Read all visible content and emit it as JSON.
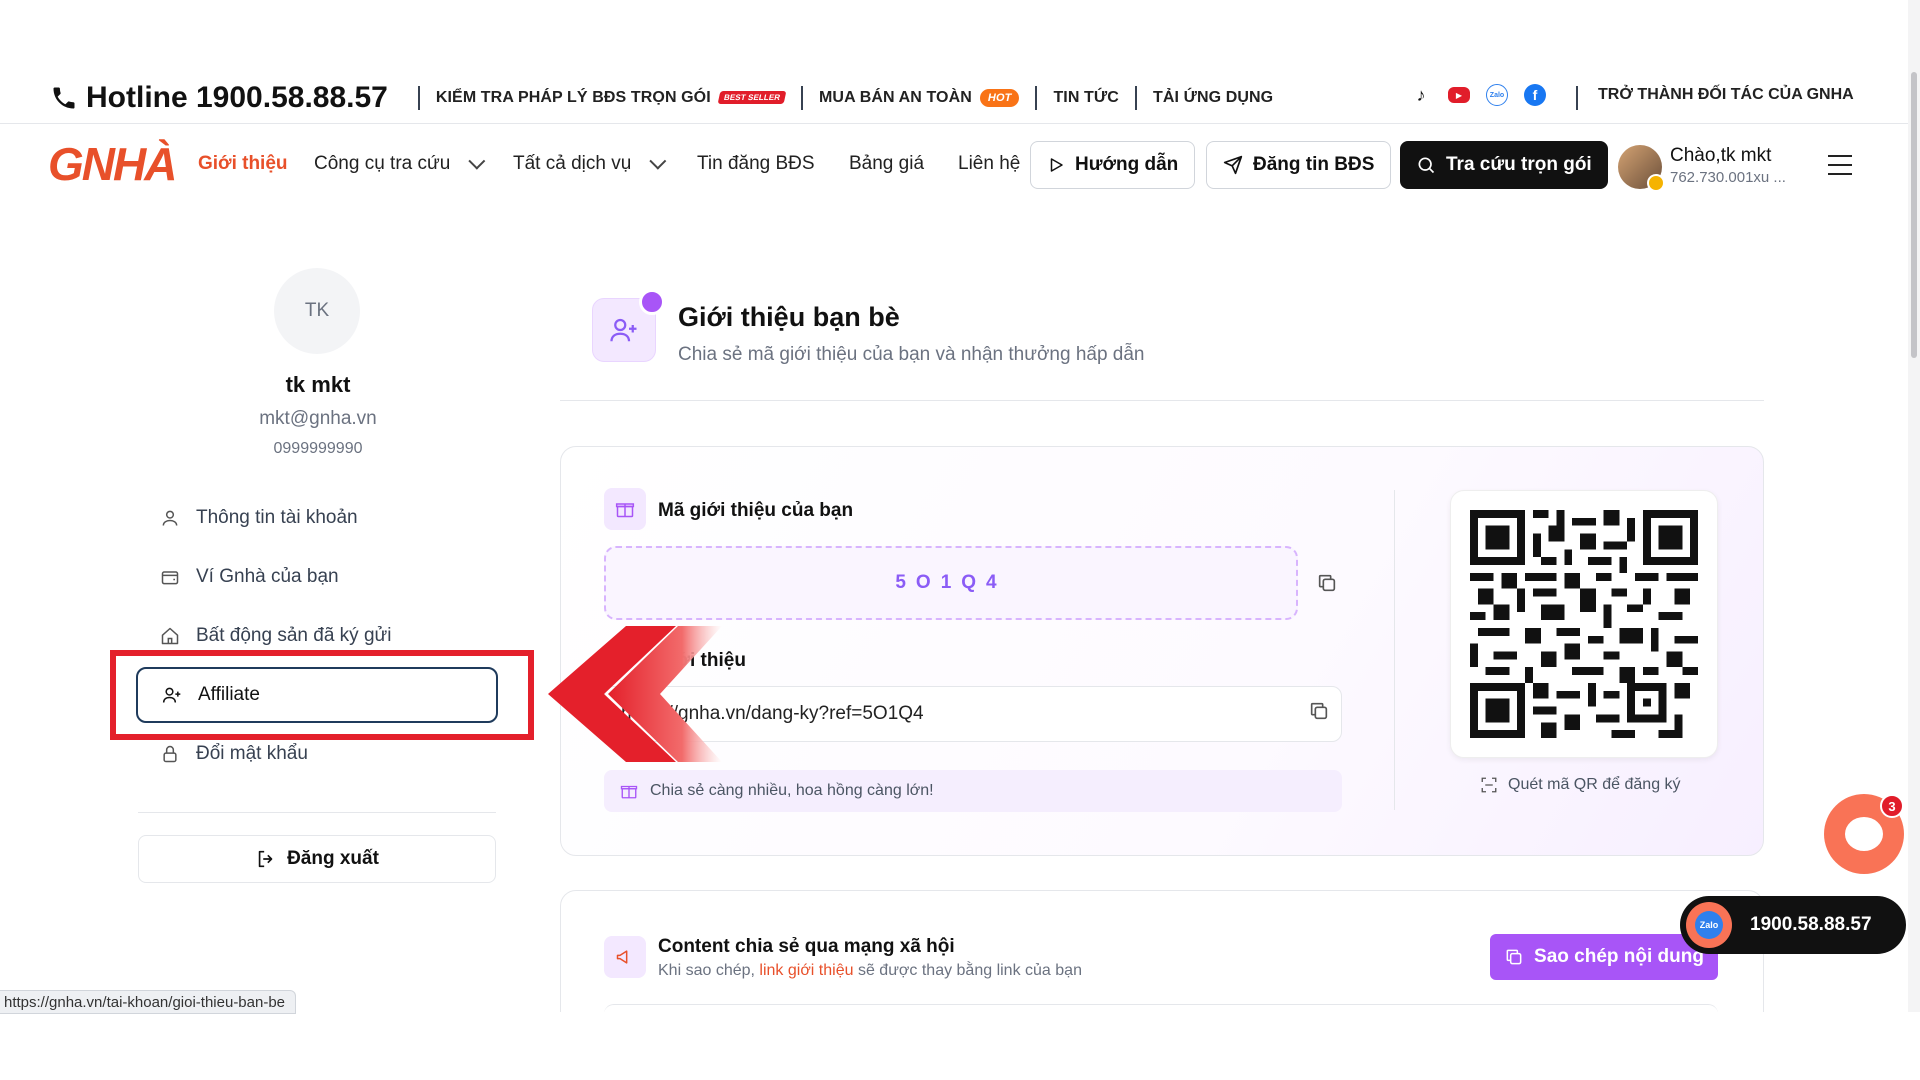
{
  "topbar": {
    "hotline": "Hotline 1900.58.88.57",
    "links": [
      {
        "label": "KIỂM TRA PHÁP LÝ BĐS TRỌN GÓI",
        "badge": "BEST SELLER"
      },
      {
        "label": "MUA BÁN AN TOÀN",
        "badge": "HOT"
      },
      {
        "label": "TIN TỨC"
      },
      {
        "label": "TẢI ỨNG DỤNG"
      }
    ],
    "socials": [
      "tiktok-icon",
      "youtube-icon",
      "zalo-icon",
      "facebook-icon"
    ],
    "zalo_text": "Zalo",
    "partner": "TRỞ THÀNH ĐỐI TÁC CỦA GNHA"
  },
  "nav": {
    "logo": "GNHÀ",
    "items": [
      "Giới thiệu",
      "Công cụ tra cứu",
      "Tất cả dịch vụ",
      "Tin đăng BĐS",
      "Bảng giá",
      "Liên hệ"
    ],
    "guide": "Hướng dẫn",
    "post": "Đăng tin BĐS",
    "lookup": "Tra cứu trọn gói",
    "greeting": "Chào,tk mkt",
    "xu": "762.730.001xu ..."
  },
  "profile": {
    "initials": "TK",
    "name": "tk mkt",
    "email": "mkt@gnha.vn",
    "phone": "0999999990"
  },
  "menu": [
    {
      "label": "Thông tin tài khoản"
    },
    {
      "label": "Ví Gnhà của bạn"
    },
    {
      "label": "Bất động sản đã ký gửi"
    },
    {
      "label": "Affiliate"
    },
    {
      "label": "Đổi mật khẩu"
    }
  ],
  "logout": "Đăng xuất",
  "main": {
    "title": "Giới thiệu bạn bè",
    "subtitle": "Chia sẻ mã giới thiệu của bạn và nhận thưởng hấp dẫn",
    "code_label": "Mã giới thiệu của bạn",
    "code": "5O1Q4",
    "link_label": "t giới thiệu",
    "link": "https://gnha.vn/dang-ky?ref=5O1Q4",
    "tip": "Chia sẻ càng nhiều, hoa hồng càng lớn!",
    "qr_label": "Quét mã QR để đăng ký"
  },
  "content": {
    "title": "Content chia sẻ qua mạng xã hội",
    "sub_prefix": "Khi sao chép,",
    "sub_highlight": "link giới thiệu",
    "sub_suffix": "sẽ được thay bằng link của bạn",
    "copy_button": "Sao chép nội dung"
  },
  "floating": {
    "chat_count": "3",
    "phone": "1900.58.88.57"
  },
  "status_url": "https://gnha.vn/tai-khoan/gioi-thieu-ban-be",
  "colors": {
    "brand": "#e8502a",
    "accent": "#a855f7",
    "highlight": "#e4202b"
  }
}
